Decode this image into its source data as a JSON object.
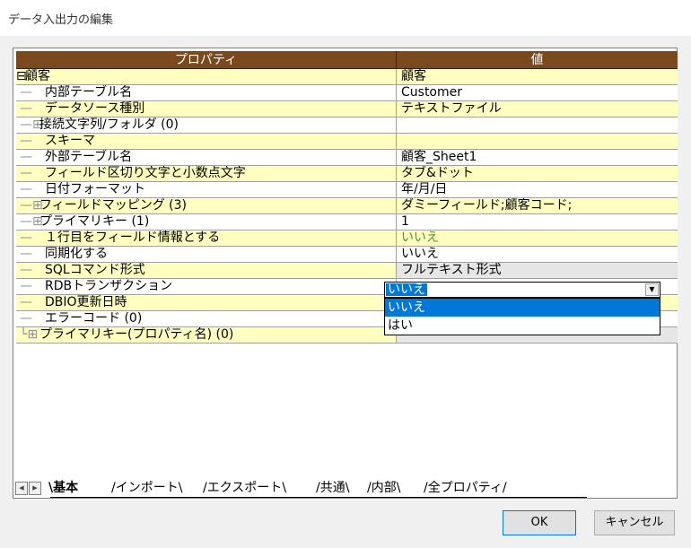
{
  "window": {
    "title": "データ入出力の編集"
  },
  "grid": {
    "header_property": "プロパティ",
    "header_value": "値",
    "rows": [
      {
        "tree": "⊟",
        "label": "顧客",
        "value": "顧客"
      },
      {
        "tree": "—",
        "label": "内部テーブル名",
        "value": "Customer"
      },
      {
        "tree": "—",
        "label": "データソース種別",
        "value": "テキストファイル"
      },
      {
        "tree": "—⊞",
        "label": "接続文字列/フォルダ (0)",
        "value": ""
      },
      {
        "tree": "—",
        "label": "スキーマ",
        "value": ""
      },
      {
        "tree": "—",
        "label": "外部テーブル名",
        "value": "顧客_Sheet1"
      },
      {
        "tree": "—",
        "label": "フィールド区切り文字と小数点文字",
        "value": "タブ&ドット"
      },
      {
        "tree": "—",
        "label": "日付フォーマット",
        "value": "年/月/日"
      },
      {
        "tree": "—⊞",
        "label": "フィールドマッピング (3)",
        "value": "ダミーフィールド;顧客コード;"
      },
      {
        "tree": "—⊞",
        "label": "プライマリキー (1)",
        "value": "1"
      },
      {
        "tree": "—",
        "label": "１行目をフィールド情報とする",
        "value": "いいえ"
      },
      {
        "tree": "—",
        "label": "同期化する",
        "value": "いいえ"
      },
      {
        "tree": "—",
        "label": "SQLコマンド形式",
        "value": "フルテキスト形式"
      },
      {
        "tree": "—",
        "label": "RDBトランザクション",
        "value": ""
      },
      {
        "tree": "—",
        "label": "DBIO更新日時",
        "value": ""
      },
      {
        "tree": "—",
        "label": "エラーコード (0)",
        "value": ""
      },
      {
        "tree": "└⊞",
        "label": "プライマリキー(プロパティ名) (0)",
        "value": ""
      }
    ]
  },
  "combo": {
    "selected": "いいえ",
    "options": [
      "いいえ",
      "はい"
    ]
  },
  "tabs": {
    "items": [
      "基本",
      "インポート",
      "エクスポート",
      "共通",
      "内部",
      "全プロパティ"
    ]
  },
  "buttons": {
    "ok": "OK",
    "cancel": "キャンセル"
  }
}
